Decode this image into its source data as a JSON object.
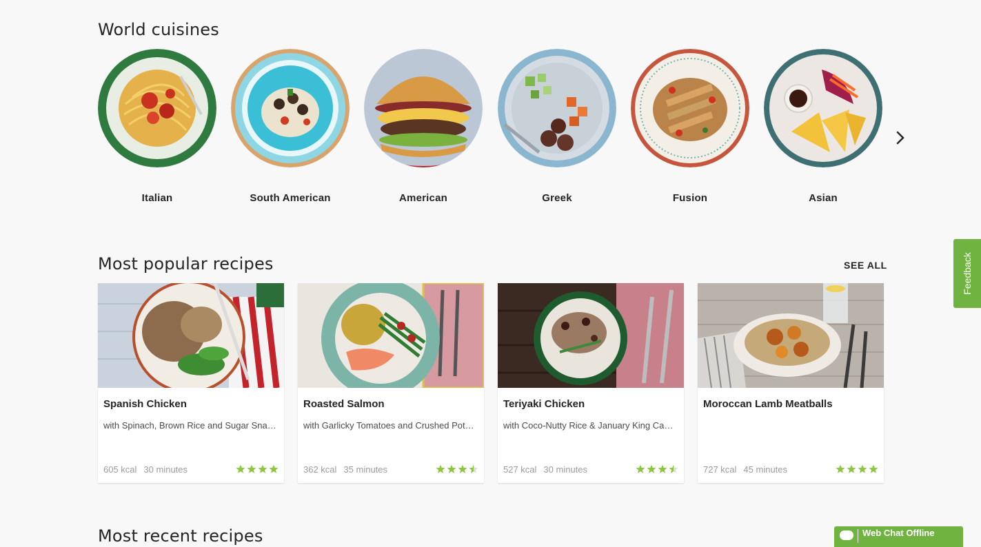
{
  "sections": {
    "world_cuisines": {
      "title": "World cuisines"
    },
    "most_popular": {
      "title": "Most popular recipes",
      "see_all": "SEE ALL"
    },
    "most_recent": {
      "title": "Most recent recipes"
    }
  },
  "cuisines": [
    {
      "label": "Italian"
    },
    {
      "label": "South American"
    },
    {
      "label": "American"
    },
    {
      "label": "Greek"
    },
    {
      "label": "Fusion"
    },
    {
      "label": "Asian"
    }
  ],
  "recipes": [
    {
      "title": "Spanish Chicken",
      "subtitle": "with Spinach, Brown Rice and Sugar Snap Peas",
      "kcal": "605 kcal",
      "time": "30 minutes",
      "rating": 4
    },
    {
      "title": "Roasted Salmon",
      "subtitle": "with Garlicky Tomatoes and Crushed Potatoes",
      "kcal": "362 kcal",
      "time": "35 minutes",
      "rating": 3.5
    },
    {
      "title": "Teriyaki Chicken",
      "subtitle": "with Coco-Nutty Rice & January King Cabbage",
      "kcal": "527 kcal",
      "time": "30 minutes",
      "rating": 3.5
    },
    {
      "title": "Moroccan Lamb Meatballs",
      "subtitle": "",
      "kcal": "727 kcal",
      "time": "45 minutes",
      "rating": 4
    }
  ],
  "widgets": {
    "feedback": "Feedback",
    "webchat": "Web Chat Offline"
  },
  "icons": {
    "next": "chevron-right-icon",
    "star": "star-icon",
    "chat": "chat-bubble-icon"
  },
  "colors": {
    "brand_green": "#71b340",
    "star_green": "#8dc63f",
    "text": "#242424",
    "muted": "#9b9b9b"
  }
}
